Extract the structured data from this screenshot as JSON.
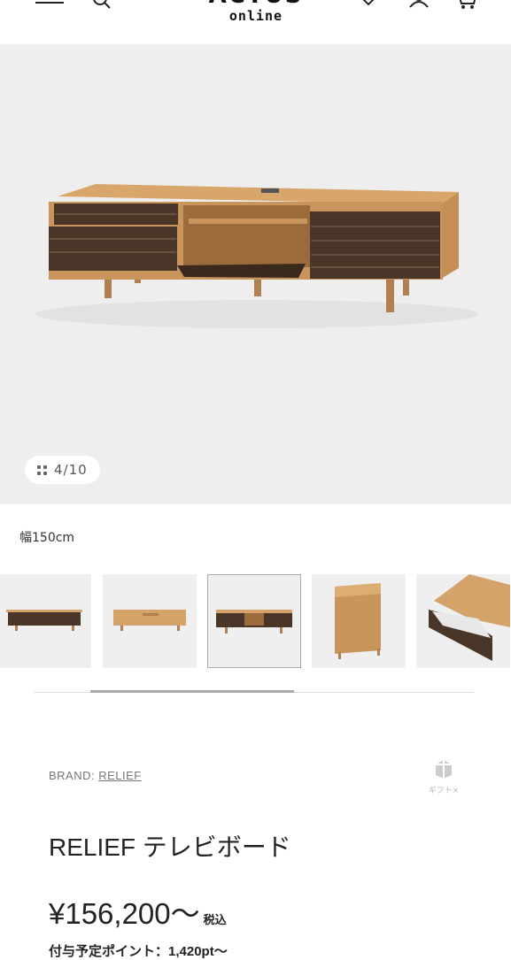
{
  "header": {
    "logo_text": "ACTUS",
    "logo_sub": "online"
  },
  "gallery": {
    "counter": "4/10",
    "current": 4,
    "total": 10
  },
  "variant": {
    "size_label": "幅150cm"
  },
  "thumbnails": [
    {
      "name": "front-dark"
    },
    {
      "name": "front-natural"
    },
    {
      "name": "open-dark",
      "selected": true
    },
    {
      "name": "side-view"
    },
    {
      "name": "drawer-detail"
    }
  ],
  "product": {
    "brand_prefix": "BRAND: ",
    "brand_name": "RELIEF",
    "gift_label": "ギフト×",
    "title": "RELIEF テレビボード",
    "price": "¥156,200～",
    "tax_label": "税込",
    "points": "付与予定ポイント：1,420pt～"
  },
  "icons": {
    "menu": "hamburger-icon",
    "search": "search-icon",
    "favorite": "heart-icon",
    "account": "user-icon",
    "cart": "cart-icon",
    "gift": "gift-icon"
  }
}
